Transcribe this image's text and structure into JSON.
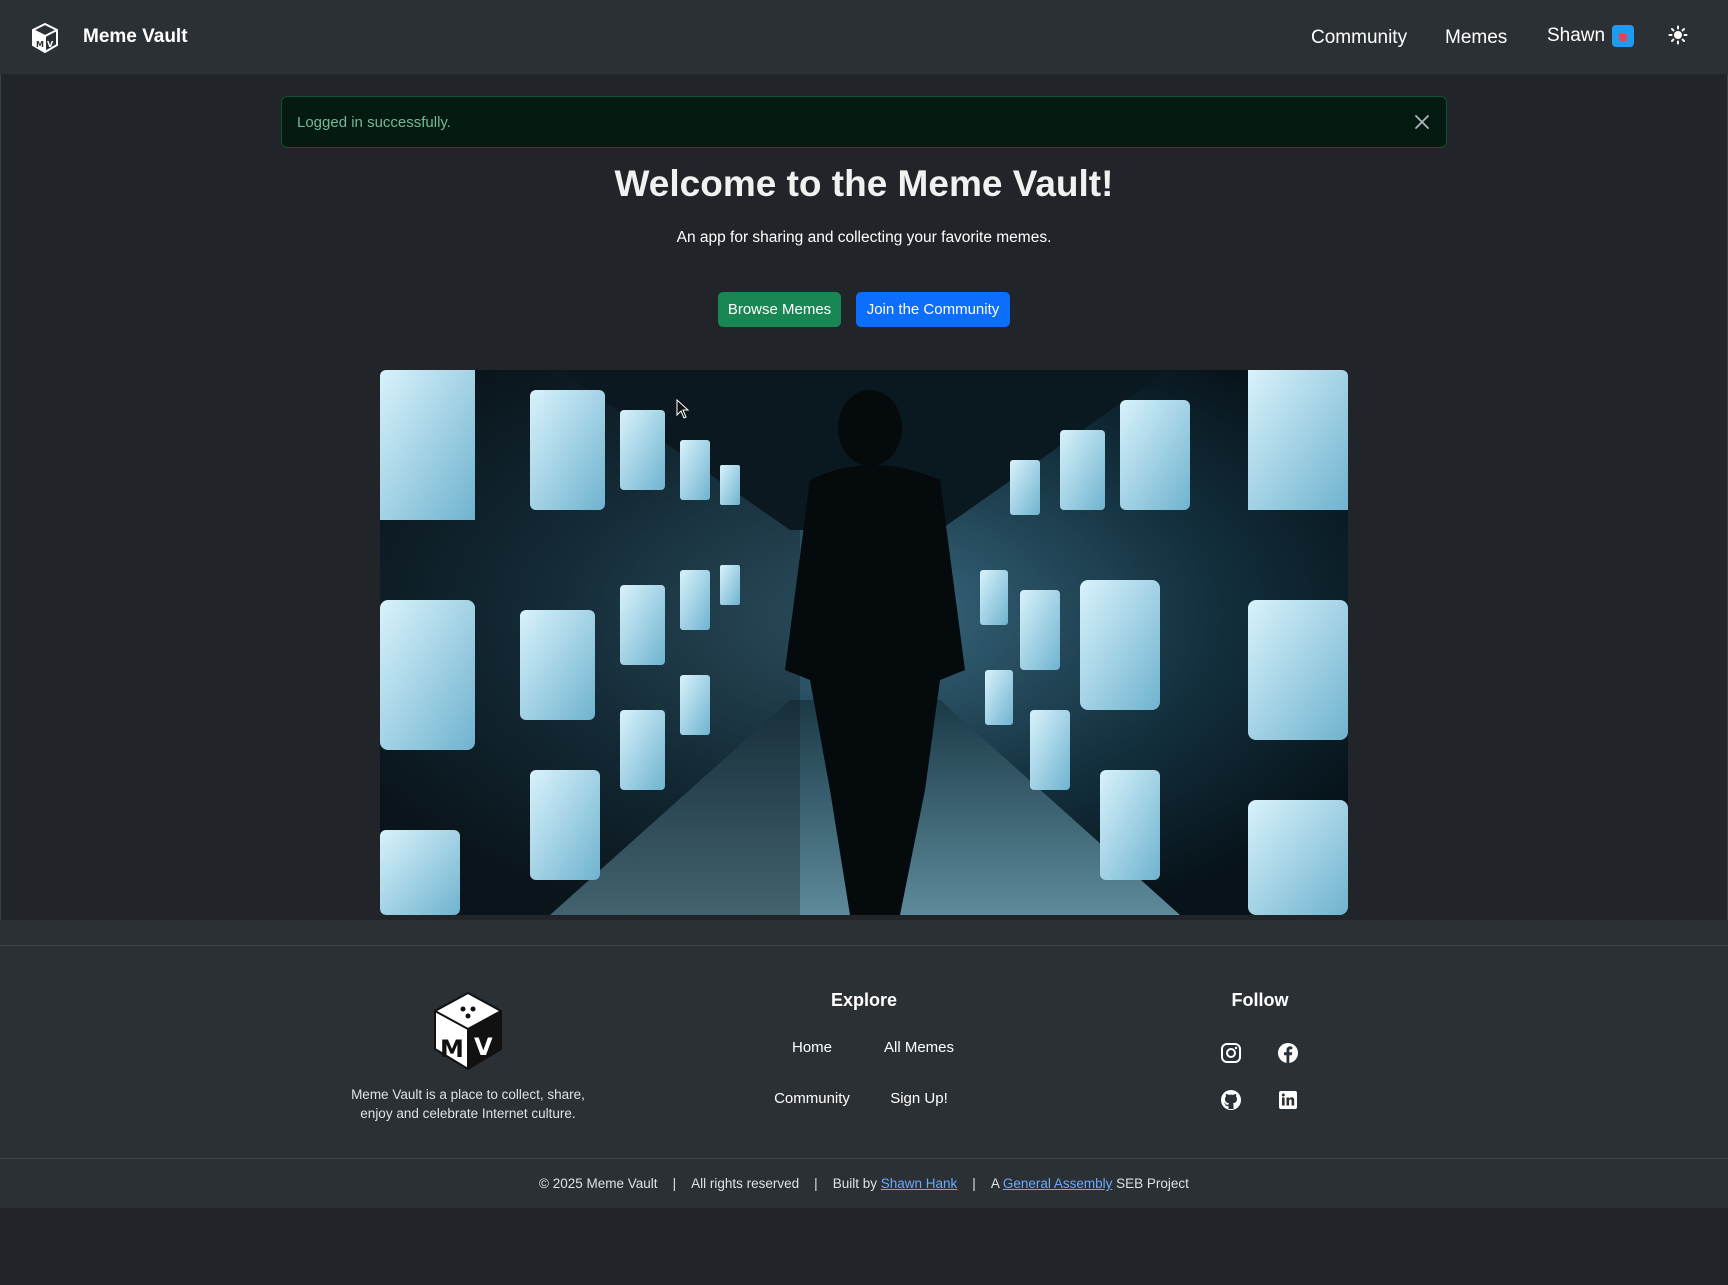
{
  "navbar": {
    "brand": "Meme Vault",
    "links": {
      "community": "Community",
      "memes": "Memes"
    },
    "user_name": "Shawn"
  },
  "alert": {
    "message": "Logged in successfully."
  },
  "hero": {
    "title": "Welcome to the Meme Vault!",
    "subtitle": "An app for sharing and collecting your favorite memes.",
    "browse_label": "Browse Memes",
    "join_label": "Join the Community"
  },
  "footer": {
    "description_line1": "Meme Vault is a place to collect, share,",
    "description_line2": "enjoy and celebrate Internet culture.",
    "explore_heading": "Explore",
    "follow_heading": "Follow",
    "links": {
      "home": "Home",
      "all_memes": "All Memes",
      "community": "Community",
      "sign_up": "Sign Up!"
    },
    "copyright": {
      "text1": "© 2025 Meme Vault",
      "text2": "All rights reserved",
      "built_by": "Built by ",
      "author": "Shawn Hank",
      "a_prefix": "A ",
      "org": "General Assembly",
      "suffix": " SEB Project",
      "separator": "|"
    }
  },
  "colors": {
    "page_bg": "#212529",
    "navbar_bg": "#2b3035",
    "success_btn": "#198754",
    "primary_btn": "#0d6efd",
    "alert_text": "#75b798",
    "link": "#6ea8fe"
  },
  "icons": {
    "brand": "meme-vault-cube-icon",
    "theme": "sun-icon",
    "close": "close-icon",
    "social": [
      "instagram-icon",
      "facebook-icon",
      "github-icon",
      "linkedin-icon"
    ]
  }
}
